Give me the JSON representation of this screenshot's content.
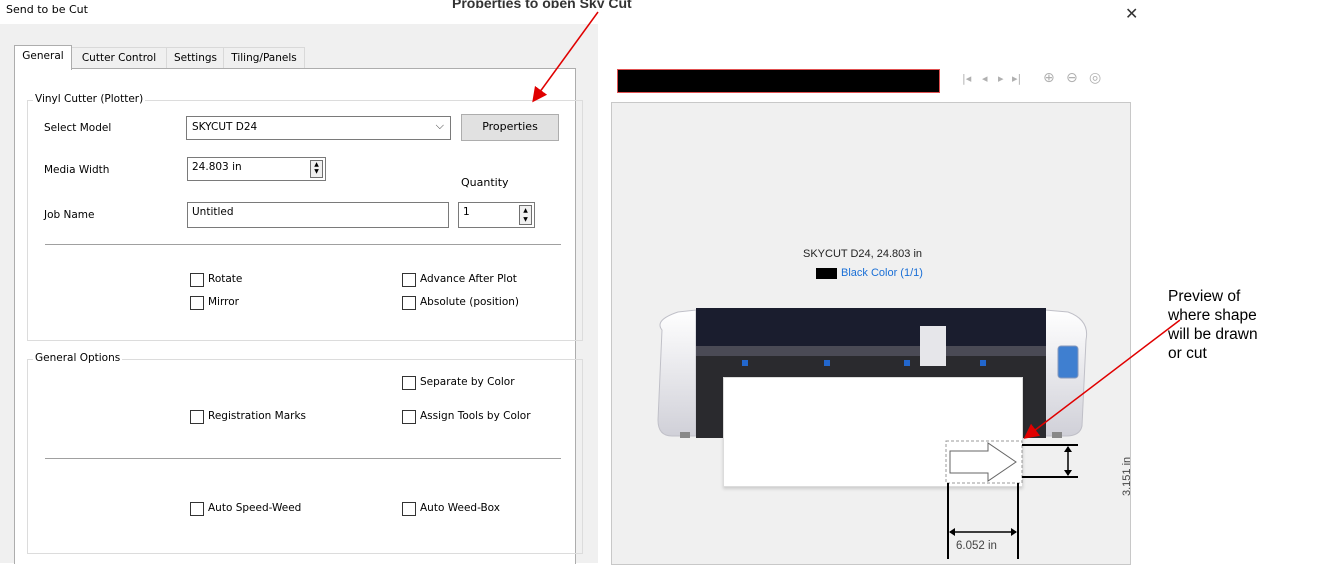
{
  "window": {
    "title": "Send to be Cut",
    "cropped_banner": "Properties to open Sky Cut"
  },
  "tabs": [
    "General",
    "Cutter Control",
    "Settings",
    "Tiling/Panels"
  ],
  "vinyl_group": {
    "legend": "Vinyl Cutter (Plotter)",
    "select_model_label": "Select Model",
    "model_value": "SKYCUT D24",
    "properties_button": "Properties",
    "media_width_label": "Media Width",
    "media_width_value": "24.803 in",
    "quantity_label": "Quantity",
    "quantity_value": "1",
    "job_name_label": "Job Name",
    "job_name_value": "Untitled",
    "rotate": "Rotate",
    "mirror": "Mirror",
    "advance_after_plot": "Advance After Plot",
    "absolute_position": "Absolute (position)"
  },
  "general_group": {
    "legend": "General Options",
    "separate_by_color": "Separate by Color",
    "registration_marks": "Registration Marks",
    "assign_tools_by_color": "Assign Tools by Color",
    "auto_speed_weed": "Auto Speed-Weed",
    "auto_weed_box": "Auto Weed-Box"
  },
  "preview": {
    "machine_caption": "SKYCUT D24,  24.803 in",
    "color_label": "Black Color (1/1)",
    "height_dim": "3.151 in",
    "width_dim": "6.052 in"
  },
  "annotation": {
    "lines": [
      "Preview of",
      "where shape",
      "will be drawn",
      "or cut"
    ]
  },
  "colors": {
    "dialog_bg": "#f0f0f0",
    "link_blue": "#1a6fd6",
    "arrow_red": "#e00000"
  },
  "icons": [
    "close-icon",
    "first-page-icon",
    "prev-page-icon",
    "next-page-icon",
    "last-page-icon",
    "zoom-in-icon",
    "zoom-out-icon",
    "fit-page-icon",
    "dropdown-arrow-icon"
  ]
}
